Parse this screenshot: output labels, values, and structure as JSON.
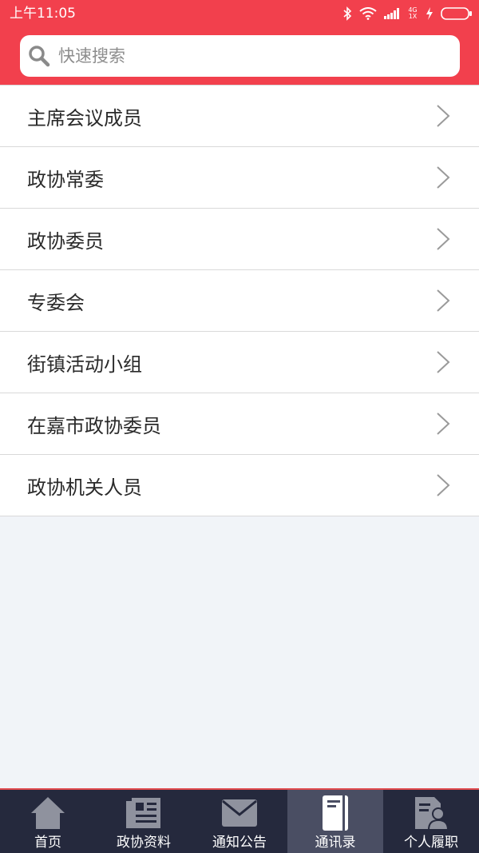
{
  "status_bar": {
    "time": "上午11:05",
    "network_top": "4G",
    "network_bottom": "1X"
  },
  "search": {
    "placeholder": "快速搜索",
    "value": ""
  },
  "list": {
    "items": [
      {
        "label": "主席会议成员"
      },
      {
        "label": "政协常委"
      },
      {
        "label": "政协委员"
      },
      {
        "label": "专委会"
      },
      {
        "label": "街镇活动小组"
      },
      {
        "label": "在嘉市政协委员"
      },
      {
        "label": "政协机关人员"
      }
    ]
  },
  "tabbar": {
    "active": "通讯录",
    "tabs": [
      {
        "label": "首页",
        "icon": "home-icon"
      },
      {
        "label": "政协资料",
        "icon": "newspaper-icon"
      },
      {
        "label": "通知公告",
        "icon": "envelope-icon"
      },
      {
        "label": "通讯录",
        "icon": "address-book-icon"
      },
      {
        "label": "个人履职",
        "icon": "profile-document-icon"
      }
    ]
  },
  "colors": {
    "header": "#f2404d",
    "tabbar": "#25293d",
    "tab_active": "#4a4e63",
    "background": "#f1f4f8"
  }
}
